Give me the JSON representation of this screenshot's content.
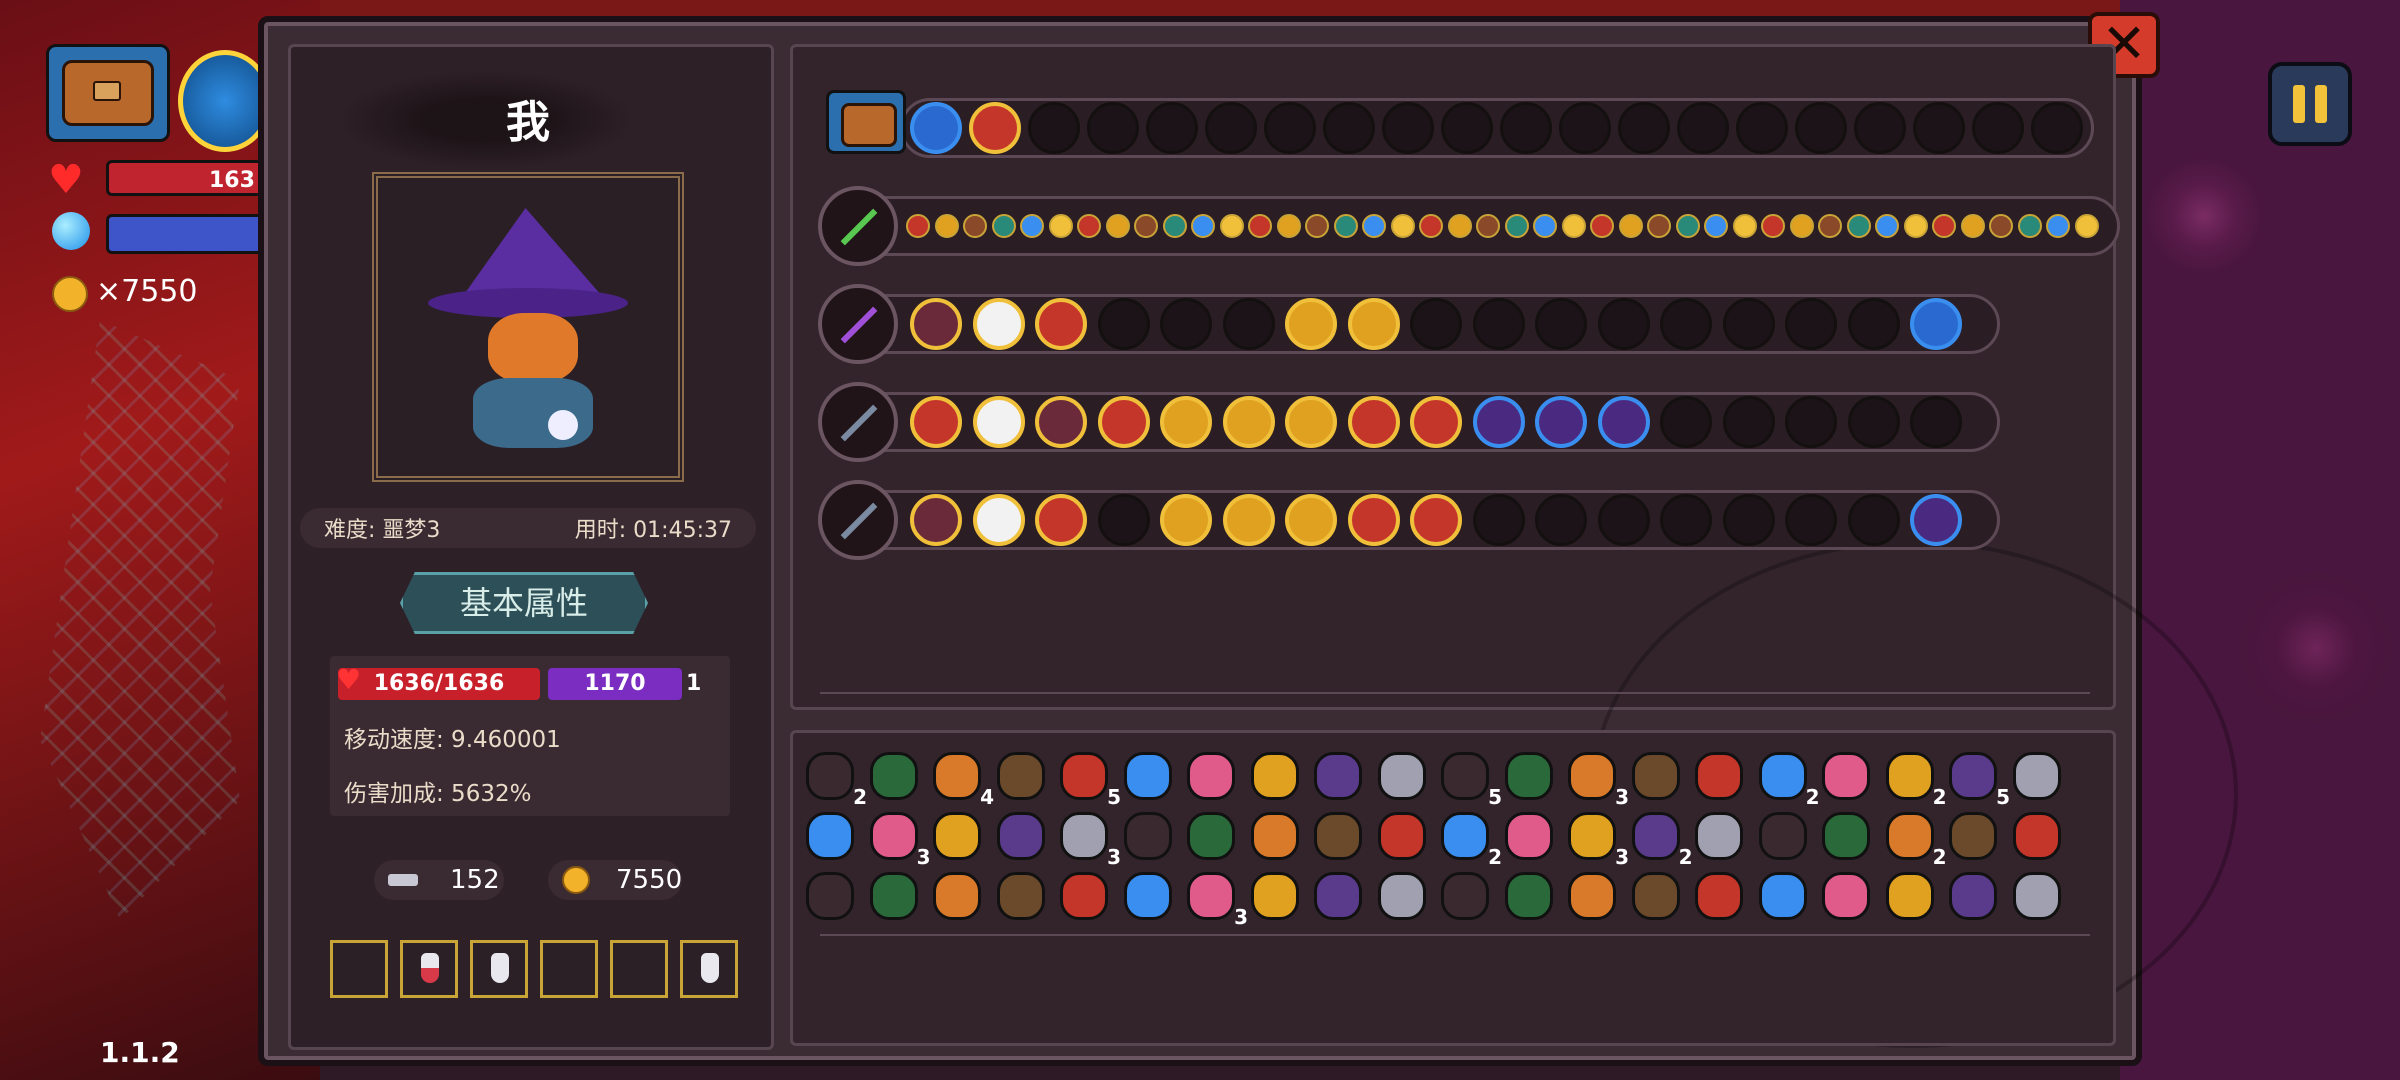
{
  "hud": {
    "hp_text": "163",
    "gold_text": "×7550",
    "version": "1.1.2"
  },
  "player": {
    "name": "我",
    "difficulty": "难度: 噩梦3",
    "time": "用时: 01:45:37"
  },
  "tabs": {
    "basic": "基本属性"
  },
  "stats": {
    "hp": "1636/1636",
    "mana": "1170",
    "mana_extra": "1",
    "move_speed": "移动速度: 9.460001",
    "damage_bonus": "伤害加成: 5632%"
  },
  "resources": {
    "keys": "152",
    "gold": "7550"
  },
  "colors": {
    "hp_red": "#c7202a",
    "mana_purple": "#7a2dc0",
    "slot_gold": "#f0c03a",
    "slot_blue": "#3a8ef0",
    "teal_tab": "#2d4f57"
  },
  "inventory_slots": [
    "empty",
    "red-potion",
    "white-potion",
    "empty",
    "empty",
    "white-potion"
  ],
  "weapon_rows": [
    {
      "weapon": "chest-bag",
      "slots": [
        "blue-orb",
        "red-shot",
        "e",
        "e",
        "e",
        "e",
        "e",
        "e",
        "e",
        "e",
        "e",
        "e",
        "e",
        "e",
        "e",
        "e",
        "e",
        "e",
        "e",
        "e"
      ]
    },
    {
      "weapon": "green-staff",
      "slots": "mini"
    },
    {
      "weapon": "purple-staff",
      "slots": [
        "mask",
        "mouse",
        "rock",
        "e",
        "e",
        "e",
        "chevron",
        "chevron",
        "e",
        "e",
        "e",
        "e",
        "e",
        "e",
        "e",
        "e",
        "blue-gun"
      ]
    },
    {
      "weapon": "dark-spear",
      "slots": [
        "target",
        "mouse",
        "mask",
        "rock",
        "lightning",
        "arrows",
        "chevron",
        "slash",
        "triangle",
        "pink",
        "pink",
        "pink",
        "e",
        "e",
        "e",
        "e",
        "e"
      ]
    },
    {
      "weapon": "black-sword",
      "slots": [
        "mask",
        "mouse",
        "rock",
        "e",
        "lightning",
        "chevron",
        "chevron",
        "slash",
        "triangle",
        "e",
        "e",
        "e",
        "e",
        "e",
        "e",
        "e",
        "purple-bolt"
      ]
    }
  ],
  "item_counts": {
    "row1": [
      "2",
      "",
      "4",
      "",
      "5",
      "",
      "",
      "",
      "",
      "",
      "5",
      "",
      "3",
      "",
      "",
      "2",
      "",
      "2",
      "5",
      ""
    ],
    "row2": [
      "",
      "3",
      "",
      "",
      "3",
      "",
      "",
      "",
      "",
      "",
      "2",
      "",
      "3",
      "2",
      "",
      "",
      "",
      "2",
      "",
      ""
    ],
    "row3": [
      "",
      "",
      "",
      "",
      "",
      "",
      "3",
      "",
      "",
      "",
      "",
      "",
      "",
      "",
      "",
      "",
      "",
      "",
      "",
      ""
    ]
  }
}
